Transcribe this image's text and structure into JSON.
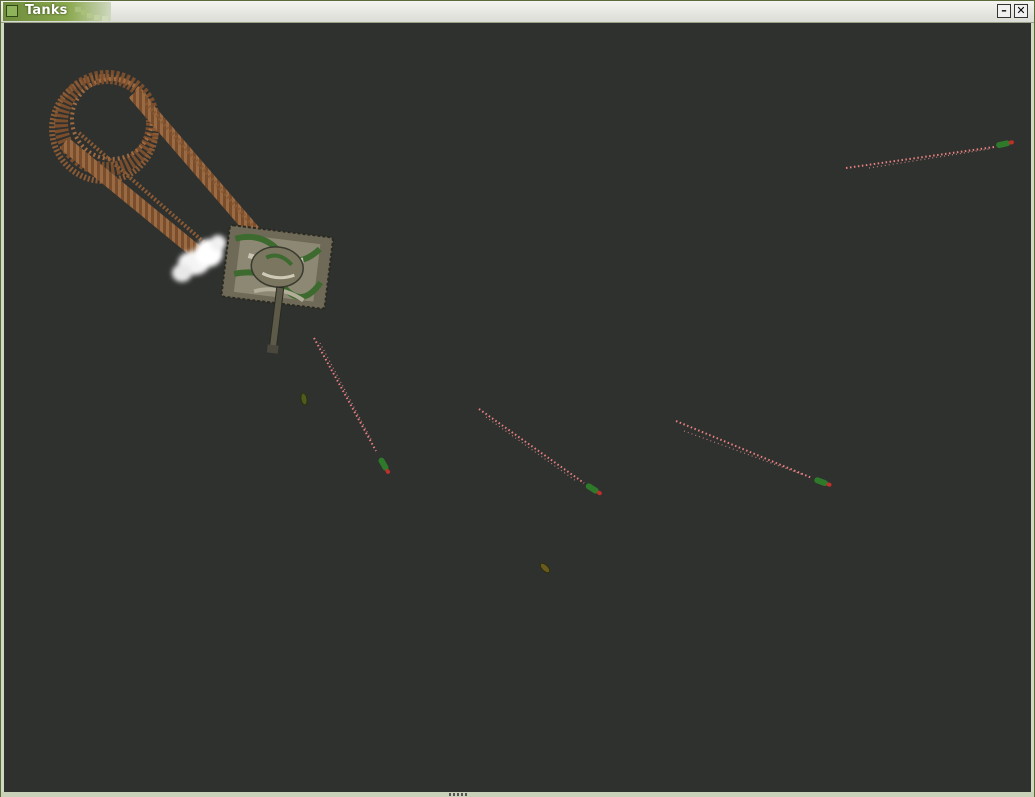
{
  "window": {
    "title": "Tanks",
    "minimize_glyph": "–",
    "close_glyph": "✕"
  },
  "colors": {
    "background": "#2f312f",
    "tread_marks": "#8a5a34",
    "tank_camo_base": "#6f6a58",
    "tank_camo_green": "#3d6a2e",
    "missile_body": "#2e7a2a",
    "missile_tip": "#c0302a",
    "exhaust_trail": "#ff8a8a",
    "smoke": "#f2f2f2",
    "titlebar_accent": "#8aa84e"
  },
  "icons": {
    "app": "tank-app-icon",
    "minimize": "minimize-icon",
    "close": "close-icon"
  }
}
